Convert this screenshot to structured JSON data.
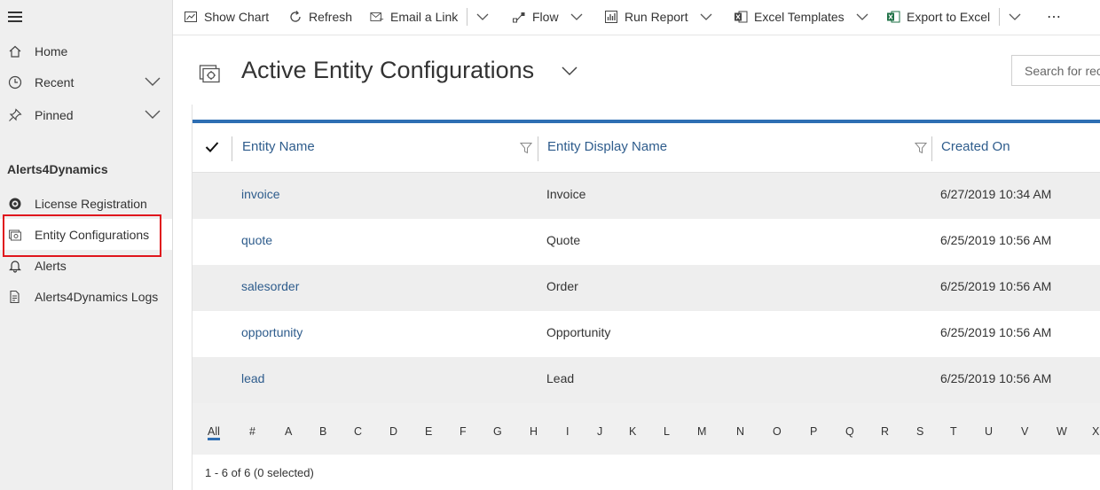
{
  "sidebar": {
    "items": [
      {
        "label": "Home",
        "icon": "home-icon"
      },
      {
        "label": "Recent",
        "icon": "clock-icon"
      },
      {
        "label": "Pinned",
        "icon": "pin-icon"
      }
    ],
    "group_title": "Alerts4Dynamics",
    "group_items": [
      {
        "label": "License Registration",
        "icon": "license-icon"
      },
      {
        "label": "Entity Configurations",
        "icon": "entity-config-icon"
      },
      {
        "label": "Alerts",
        "icon": "bell-icon"
      },
      {
        "label": "Alerts4Dynamics Logs",
        "icon": "log-icon"
      }
    ]
  },
  "commands": {
    "show_chart": "Show Chart",
    "refresh": "Refresh",
    "email_link": "Email a Link",
    "flow": "Flow",
    "run_report": "Run Report",
    "excel_templates": "Excel Templates",
    "export_excel": "Export to Excel",
    "more": "⋯"
  },
  "view": {
    "title": "Active Entity Configurations",
    "search_placeholder": "Search for rec"
  },
  "grid": {
    "columns": [
      "Entity Name",
      "Entity Display Name",
      "Created On"
    ],
    "rows": [
      {
        "name": "invoice",
        "display": "Invoice",
        "created": "6/27/2019 10:34 AM"
      },
      {
        "name": "quote",
        "display": "Quote",
        "created": "6/25/2019 10:56 AM"
      },
      {
        "name": "salesorder",
        "display": "Order",
        "created": "6/25/2019 10:56 AM"
      },
      {
        "name": "opportunity",
        "display": "Opportunity",
        "created": "6/25/2019 10:56 AM"
      },
      {
        "name": "lead",
        "display": "Lead",
        "created": "6/25/2019 10:56 AM"
      }
    ],
    "alphabet": [
      "All",
      "#",
      "A",
      "B",
      "C",
      "D",
      "E",
      "F",
      "G",
      "H",
      "I",
      "J",
      "K",
      "L",
      "M",
      "N",
      "O",
      "P",
      "Q",
      "R",
      "S",
      "T",
      "U",
      "V",
      "W",
      "X"
    ],
    "footer": "1 - 6 of 6 (0 selected)"
  },
  "colors": {
    "accent": "#2e6eb3",
    "link": "#2e5c8c",
    "highlight": "#e0161d",
    "excel_green": "#1e7145"
  }
}
